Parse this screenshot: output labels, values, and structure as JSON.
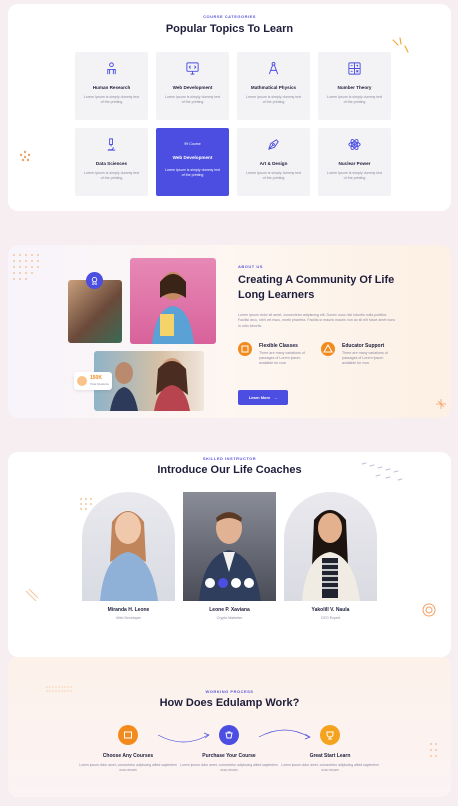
{
  "topics": {
    "eyebrow": "COURSE CATEGORIES",
    "title": "Popular Topics To Learn",
    "cards": [
      {
        "title": "Human Research",
        "desc": "Lorem Ipsum is simply dummy text of the printing",
        "icon": "person-research-icon"
      },
      {
        "title": "Web Development",
        "desc": "Lorem Ipsum is simply dummy text of the printing",
        "icon": "monitor-code-icon"
      },
      {
        "title": "Mathmatical Physics",
        "desc": "Lorem Ipsum is simply dummy text of the printing",
        "icon": "compass-icon"
      },
      {
        "title": "Number Theory",
        "desc": "Lorem Ipsum is simply dummy text of the printing",
        "icon": "calculator-icon"
      },
      {
        "title": "Data Sciences",
        "desc": "Lorem Ipsum is simply dummy text of the printing",
        "icon": "microscope-icon"
      },
      {
        "title": "Web Development",
        "badge": "99 Course",
        "desc": "Lorem Ipsum is simply dummy text of the printing",
        "icon": "monitor-code-icon"
      },
      {
        "title": "Art & Design",
        "desc": "Lorem Ipsum is simply dummy text of the printing",
        "icon": "pen-nib-icon"
      },
      {
        "title": "Nuclear Power",
        "desc": "Lorem Ipsum is simply dummy text of the printing",
        "icon": "atom-icon"
      }
    ]
  },
  "about": {
    "eyebrow": "ABOUT US",
    "title_line1": "Creating A Community Of Life",
    "title_line2": "Long Learners",
    "body": "Lorem ipsum dolor sit amet, consectetur adipiscing elit. Donec nunc nisl lobortis nulla porttitor. Facilisi arcu, nibh vel risus, morbi pharetra. Facilisi ut mauris mauris non ac sit elit fusce amet nunc in odio lobortis.",
    "features": [
      {
        "title": "Flexible Classes",
        "desc": "There are many variations of passages of Lorem Ipsum available for now"
      },
      {
        "title": "Educator Support",
        "desc": "There are many variations of passages of Lorem Ipsum available for now"
      }
    ],
    "button_label": "Learn More",
    "badge_count": "150K",
    "badge_label": "Total Students",
    "colors": {
      "accent": "#4b4ee0",
      "orange": "#f28a1e"
    }
  },
  "coaches": {
    "eyebrow": "SKILLED INSTRUCTOR",
    "title": "Introduce Our Life Coaches",
    "items": [
      {
        "name": "Miranda H. Leone",
        "role": "Web Developer"
      },
      {
        "name": "Leone P. Xaviana",
        "role": "Crypto Marketer"
      },
      {
        "name": "Yakolill V. Naula",
        "role": "CEO Expert"
      }
    ]
  },
  "process": {
    "eyebrow": "WORKING PROCESS",
    "title": "How Does Edulamp Work?",
    "steps": [
      {
        "title": "Choose Any Courses",
        "desc": "Lorem ipsum dolor amet, consectetur adipiscing alited sapientem occu ercam"
      },
      {
        "title": "Purchase Your Course",
        "desc": "Lorem ipsum dolor amet, consectetur adipiscing alited sapientem occu ercam"
      },
      {
        "title": "Great Start Learn",
        "desc": "Lorem ipsum dolor amet, consectetur adipiscing alited sapientem occu ercam"
      }
    ]
  }
}
